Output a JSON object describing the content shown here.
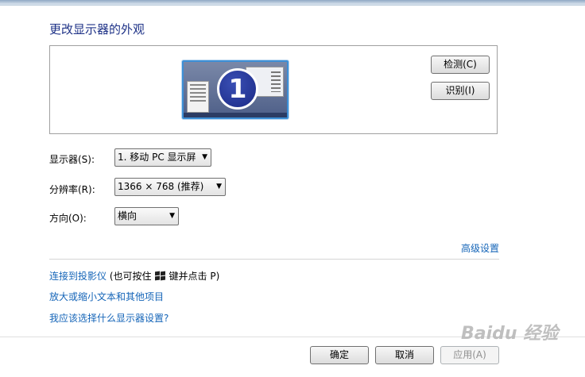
{
  "window": {
    "title": "更改显示器的外观"
  },
  "preview": {
    "monitor_number": "1"
  },
  "actions": {
    "detect_label": "检测(C)",
    "identify_label": "识别(I)"
  },
  "settings": {
    "display": {
      "label": "显示器(S):",
      "value": "1. 移动 PC 显示屏"
    },
    "resolution": {
      "label": "分辨率(R):",
      "value": "1366 × 768 (推荐)"
    },
    "orientation": {
      "label": "方向(O):",
      "value": "横向"
    }
  },
  "advanced_link": "高级设置",
  "links": {
    "projector_link": "连接到投影仪",
    "projector_hint_prefix": "(也可按住",
    "projector_hint_suffix": "键并点击 P)",
    "text_size_link": "放大或缩小文本和其他项目",
    "which_display_link": "我应该选择什么显示器设置?"
  },
  "footer": {
    "ok_label": "确定",
    "cancel_label": "取消",
    "apply_label": "应用(A)"
  },
  "watermark": "Baidu 经验"
}
